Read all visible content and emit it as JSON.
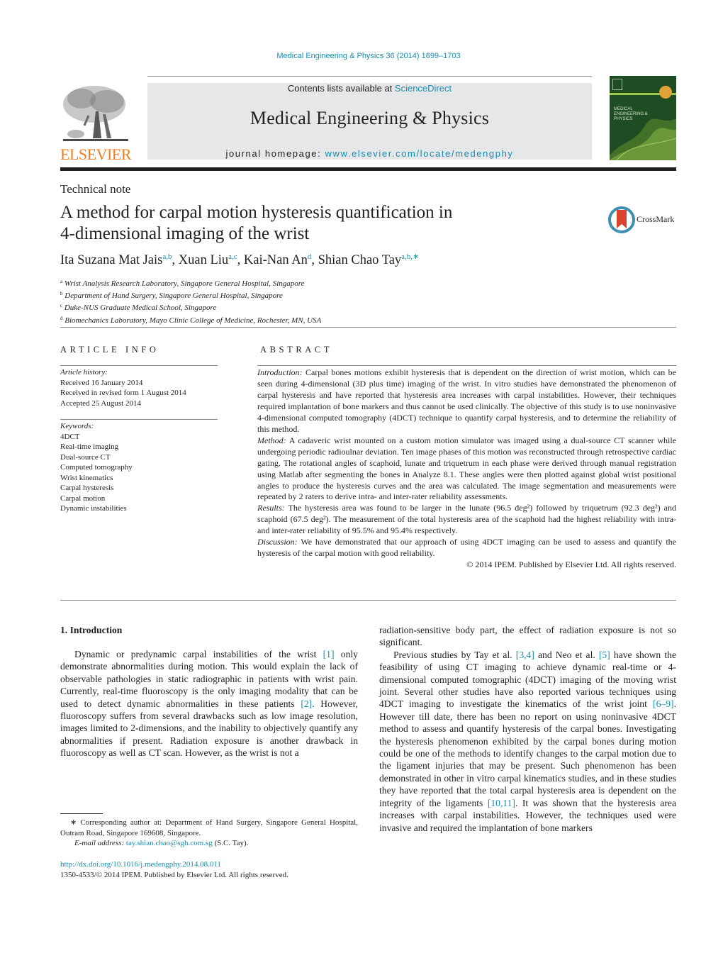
{
  "header": {
    "citation": "Medical Engineering & Physics 36 (2014) 1699–1703",
    "contents_prefix": "Contents lists available at ",
    "contents_link": "ScienceDirect",
    "journal_name": "Medical Engineering & Physics",
    "homepage_prefix": "journal homepage: ",
    "homepage_link": "www.elsevier.com/locate/medengphy",
    "publisher_logo_text": "ELSEVIER",
    "cover_title": "MEDICAL ENGINEERING & PHYSICS",
    "colors": {
      "link": "#1a8bb0",
      "elsevier_orange": "#f47b20",
      "cover_green": "#1f4d23",
      "banner_gray": "#e6e7e8"
    }
  },
  "article": {
    "type": "Technical note",
    "title_line1": "A method for carpal motion hysteresis quantification in",
    "title_line2": "4-dimensional imaging of the wrist",
    "crossmark_label": "CrossMark",
    "authors": [
      {
        "name": "Ita Suzana Mat Jais",
        "sup": "a,b"
      },
      {
        "name": "Xuan Liu",
        "sup": "a,c"
      },
      {
        "name": "Kai-Nan An",
        "sup": "d"
      },
      {
        "name": "Shian Chao Tay",
        "sup": "a,b,∗"
      }
    ],
    "affiliations": [
      {
        "key": "a",
        "text": "Wrist Analysis Research Laboratory, Singapore General Hospital, Singapore"
      },
      {
        "key": "b",
        "text": "Department of Hand Surgery, Singapore General Hospital, Singapore"
      },
      {
        "key": "c",
        "text": "Duke-NUS Graduate Medical School, Singapore"
      },
      {
        "key": "d",
        "text": "Biomechanics Laboratory, Mayo Clinic College of Medicine, Rochester, MN, USA"
      }
    ]
  },
  "article_info": {
    "heading": "ARTICLE INFO",
    "history_label": "Article history:",
    "history": [
      "Received 16 January 2014",
      "Received in revised form 1 August 2014",
      "Accepted 25 August 2014"
    ],
    "keywords_label": "Keywords:",
    "keywords": [
      "4DCT",
      "Real-time imaging",
      "Dual-source CT",
      "Computed tomography",
      "Wrist kinematics",
      "Carpal hysteresis",
      "Carpal motion",
      "Dynamic instabilities"
    ]
  },
  "abstract": {
    "heading": "ABSTRACT",
    "sections": [
      {
        "label": "Introduction:",
        "text": " Carpal bones motions exhibit hysteresis that is dependent on the direction of wrist motion, which can be seen during 4-dimensional (3D plus time) imaging of the wrist. In vitro studies have demonstrated the phenomenon of carpal hysteresis and have reported that hysteresis area increases with carpal instabilities. However, their techniques required implantation of bone markers and thus cannot be used clinically. The objective of this study is to use noninvasive 4-dimensional computed tomography (4DCT) technique to quantify carpal hysteresis, and to determine the reliability of this method."
      },
      {
        "label": "Method:",
        "text": " A cadaveric wrist mounted on a custom motion simulator was imaged using a dual-source CT scanner while undergoing periodic radioulnar deviation. Ten image phases of this motion was reconstructed through retrospective cardiac gating. The rotational angles of scaphoid, lunate and triquetrum in each phase were derived through manual registration using Matlab after segmenting the bones in Analyze 8.1. These angles were then plotted against global wrist positional angles to produce the hysteresis curves and the area was calculated. The image segmentation and measurements were repeated by 2 raters to derive intra- and inter-rater reliability assessments."
      },
      {
        "label": "Results:",
        "text": " The hysteresis area was found to be larger in the lunate (96.5 deg²) followed by triquetrum (92.3 deg²) and scaphoid (67.5 deg²). The measurement of the total hysteresis area of the scaphoid had the highest reliability with intra- and inter-rater reliability of 95.5% and 95.4% respectively."
      },
      {
        "label": "Discussion:",
        "text": " We have demonstrated that our approach of using 4DCT imaging can be used to assess and quantify the hysteresis of the carpal motion with good reliability."
      }
    ],
    "copyright": "© 2014 IPEM. Published by Elsevier Ltd. All rights reserved."
  },
  "body": {
    "section1_heading": "1.  Introduction",
    "left_para": {
      "t1": "Dynamic or predynamic carpal instabilities of the wrist ",
      "r1": "[1]",
      "t2": " only demonstrate abnormalities during motion. This would explain the lack of observable pathologies in static radiographic in patients with wrist pain. Currently, real-time fluoroscopy is the only imaging modality that can be used to detect dynamic abnormalities in these patients ",
      "r2": "[2]",
      "t3": ". However, fluoroscopy suffers from several drawbacks such as low image resolution, images limited to 2-dimensions, and the inability to objectively quantify any abnormalities if present. Radiation exposure is another drawback in fluoroscopy as well as CT scan. However, as the wrist is not a"
    },
    "right_para1": "radiation-sensitive body part, the effect of radiation exposure is not so significant.",
    "right_para2": {
      "t1": "Previous studies by Tay et al. ",
      "r1": "[3,4]",
      "t2": " and Neo et al. ",
      "r2": "[5]",
      "t3": " have shown the feasibility of using CT imaging to achieve dynamic real-time or 4-dimensional computed tomographic (4DCT) imaging of the moving wrist joint. Several other studies have also reported various techniques using 4DCT imaging to investigate the kinematics of the wrist joint ",
      "r3": "[6–9]",
      "t4": ". However till date, there has been no report on using noninvasive 4DCT method to assess and quantify hysteresis of the carpal bones. Investigating the hysteresis phenomenon exhibited by the carpal bones during motion could be one of the methods to identify changes to the carpal motion due to the ligament injuries that may be present. Such phenomenon has been demonstrated in other in vitro carpal kinematics studies, and in these studies they have reported that the total carpal hysteresis area is dependent on the integrity of the ligaments ",
      "r4": "[10,11]",
      "t5": ". It was shown that the hysteresis area increases with carpal instabilities. However, the techniques used were invasive and required the implantation of bone markers"
    }
  },
  "footnotes": {
    "corresponding": "∗  Corresponding author at: Department of Hand Surgery, Singapore General Hospital, Outram Road, Singapore 169608, Singapore.",
    "email_label": "E-mail address:",
    "email": "tay.shian.chao@sgh.com.sg",
    "email_suffix": " (S.C. Tay).",
    "doi": "http://dx.doi.org/10.1016/j.medengphy.2014.08.011",
    "issn_line": "1350-4533/© 2014 IPEM. Published by Elsevier Ltd. All rights reserved."
  }
}
